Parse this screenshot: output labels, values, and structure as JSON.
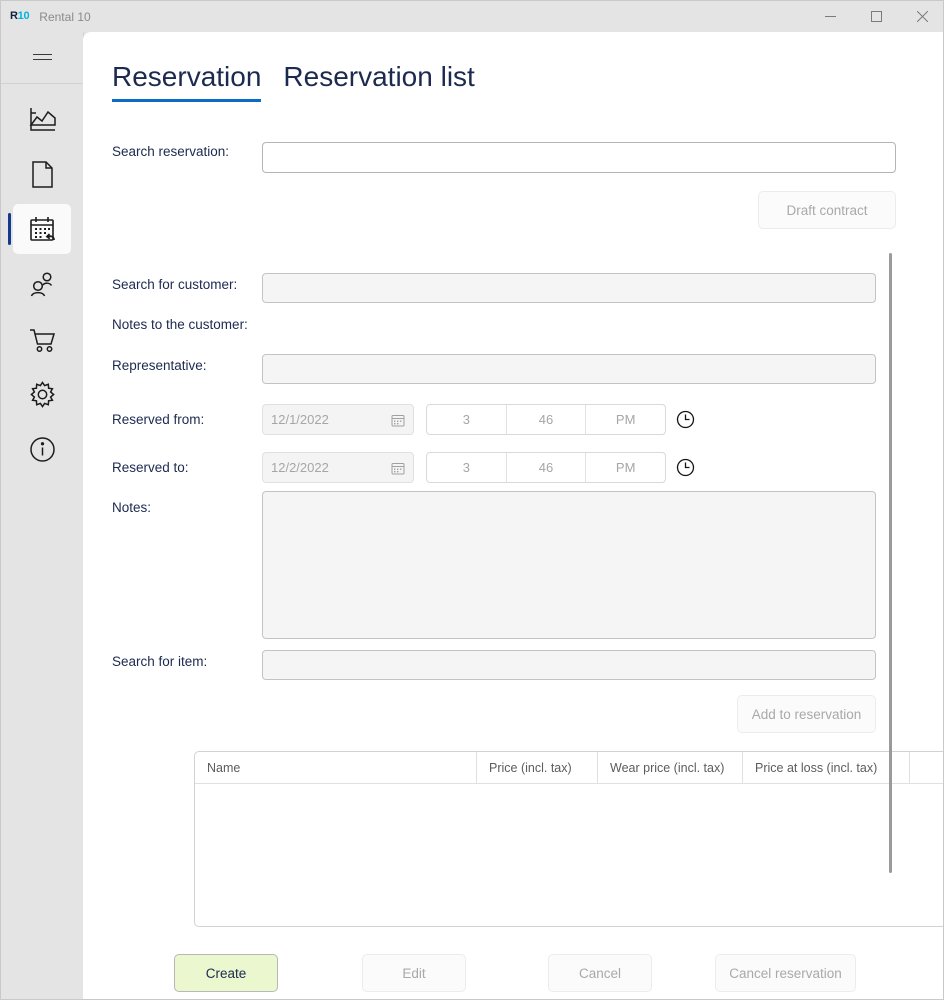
{
  "window": {
    "logo_r": "R",
    "logo_num": "10",
    "title": "Rental 10",
    "controls": {
      "minimize": "minimize-button",
      "maximize": "maximize-button",
      "close": "close-button"
    }
  },
  "sidebar": {
    "menu_label": "hamburger-menu",
    "items": [
      {
        "name": "dashboard",
        "icon": "chart-icon",
        "selected": false
      },
      {
        "name": "documents",
        "icon": "document-icon",
        "selected": false
      },
      {
        "name": "reservations",
        "icon": "calendar-return-icon",
        "selected": true
      },
      {
        "name": "customers",
        "icon": "people-icon",
        "selected": false
      },
      {
        "name": "orders",
        "icon": "shopping-cart-icon",
        "selected": false
      },
      {
        "name": "settings",
        "icon": "gear-icon",
        "selected": false
      },
      {
        "name": "about",
        "icon": "info-icon",
        "selected": false
      }
    ]
  },
  "tabs": [
    {
      "label": "Reservation",
      "active": true
    },
    {
      "label": "Reservation list",
      "active": false
    }
  ],
  "form": {
    "search_reservation_label": "Search reservation:",
    "search_reservation_value": "",
    "draft_contract_label": "Draft contract",
    "search_customer_label": "Search for customer:",
    "search_customer_value": "",
    "notes_to_customer_label": "Notes to the customer:",
    "representative_label": "Representative:",
    "representative_value": "",
    "reserved_from_label": "Reserved from:",
    "reserved_from_date": "12/1/2022",
    "reserved_from_hour": "3",
    "reserved_from_minute": "46",
    "reserved_from_meridiem": "PM",
    "reserved_to_label": "Reserved to:",
    "reserved_to_date": "12/2/2022",
    "reserved_to_hour": "3",
    "reserved_to_minute": "46",
    "reserved_to_meridiem": "PM",
    "notes_label": "Notes:",
    "notes_value": "",
    "search_item_label": "Search for item:",
    "search_item_value": "",
    "add_to_reservation_label": "Add to reservation"
  },
  "items_table": {
    "columns": [
      "Name",
      "Price (incl. tax)",
      "Wear price (incl. tax)",
      "Price at loss (incl. tax)",
      ""
    ],
    "rows": []
  },
  "actions": {
    "create_label": "Create",
    "edit_label": "Edit",
    "cancel_label": "Cancel",
    "cancel_reservation_label": "Cancel reservation"
  },
  "colors": {
    "accent": "#0d6bc4",
    "nav_indicator": "#133a8e",
    "primary_button_bg": "#eaf7cf",
    "text": "#1c2a4f",
    "muted": "#a9a9a9"
  }
}
